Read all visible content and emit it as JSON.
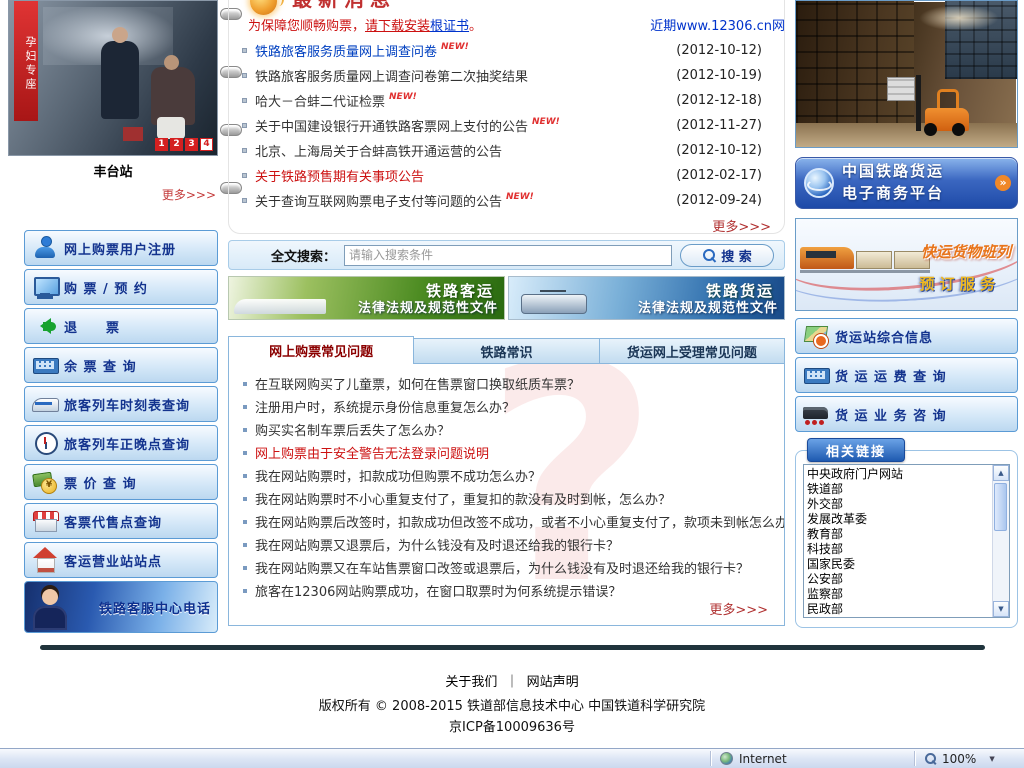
{
  "icons": {
    "scroll_up": "▲",
    "scroll_down": "▼",
    "dropdown_arrow": "▼",
    "arrow_badge": "»"
  },
  "top": {
    "heading": "最新消息",
    "notice_p1": "为保障您顺畅购票，",
    "notice_p2": "请下载安装",
    "notice_link": "根证书",
    "notice_suffix": "。",
    "notice_right": "近期www.12306.cn网"
  },
  "carousel": {
    "photo_banner": "孕妇专座",
    "caption": "丰台站",
    "more": "更多>>>",
    "pages": [
      "1",
      "2",
      "3",
      "4"
    ]
  },
  "left_menu": {
    "items": [
      {
        "label": "网上购票用户注册"
      },
      {
        "label": "购 票 / 预 约"
      },
      {
        "label": "退　　票"
      },
      {
        "label": "余 票 查 询"
      },
      {
        "label": "旅客列车时刻表查询"
      },
      {
        "label": "旅客列车正晚点查询"
      },
      {
        "label": "票 价 查 询"
      },
      {
        "label": "客票代售点查询"
      },
      {
        "label": "客运营业站站点"
      },
      {
        "label": "铁路客服中心电话"
      }
    ]
  },
  "news": {
    "new_label": "NEW!",
    "more": "更多>>>",
    "items": [
      {
        "title": "铁路旅客服务质量网上调查问卷",
        "date": "(2012-10-12)"
      },
      {
        "title": "铁路旅客服务质量网上调查问卷第二次抽奖结果",
        "date": "(2012-10-19)"
      },
      {
        "title": "哈大－合蚌二代证检票",
        "date": "(2012-12-18)"
      },
      {
        "title": "关于中国建设银行开通铁路客票网上支付的公告",
        "date": "(2012-11-27)"
      },
      {
        "title": "北京、上海局关于合蚌高铁开通运营的公告",
        "date": "(2012-10-12)"
      },
      {
        "title": "关于铁路预售期有关事项公告",
        "date": "(2012-02-17)"
      },
      {
        "title": "关于查询互联网购票电子支付等问题的公告",
        "date": "(2012-09-24)"
      }
    ]
  },
  "search": {
    "label": "全文搜索：",
    "placeholder": "请输入搜索条件",
    "button": "搜 索"
  },
  "legal_banners": {
    "passenger": {
      "title": "铁路客运",
      "subtitle": "法律法规及规范性文件"
    },
    "freight": {
      "title": "铁路货运",
      "subtitle": "法律法规及规范性文件"
    }
  },
  "faq": {
    "tabs": [
      "网上购票常见问题",
      "铁路常识",
      "货运网上受理常见问题"
    ],
    "watermark": "?",
    "more": "更多>>>",
    "items": [
      {
        "text": "在互联网购买了儿童票，如何在售票窗口换取纸质车票？"
      },
      {
        "text": "注册用户时，系统提示身份信息重复怎么办？"
      },
      {
        "text": "购买实名制车票后丢失了怎么办？"
      },
      {
        "text": "网上购票由于安全警告无法登录问题说明"
      },
      {
        "text": "我在网站购票时，扣款成功但购票不成功怎么办？"
      },
      {
        "text": "我在网站购票时不小心重复支付了，重复扣的款没有及时到帐，怎么办？"
      },
      {
        "text": "我在网站购票后改签时，扣款成功但改签不成功，或者不小心重复支付了，款项未到帐怎么办？"
      },
      {
        "text": "我在网站购票又退票后，为什么钱没有及时退还给我的银行卡？"
      },
      {
        "text": "我在网站购票又在车站售票窗口改签或退票后，为什么钱没有及时退还给我的银行卡？"
      },
      {
        "text": "旅客在12306网站购票成功，在窗口取票时为何系统提示错误？"
      }
    ]
  },
  "right_col": {
    "ecommerce": {
      "line1": "中国铁路货运",
      "line2": "电子商务平台"
    },
    "express": {
      "line1": "快运货物班列",
      "line2": "预 订 服 务"
    },
    "buttons": [
      {
        "label": "货运站综合信息"
      },
      {
        "label": "货 运 运 费 查 询"
      },
      {
        "label": "货 运 业 务 咨 询"
      }
    ],
    "related_links_title": "相关链接",
    "links": [
      "中央政府门户网站",
      "铁道部",
      "外交部",
      "发展改革委",
      "教育部",
      "科技部",
      "国家民委",
      "公安部",
      "监察部",
      "民政部"
    ]
  },
  "footer": {
    "link1": "关于我们",
    "separator": "｜",
    "link2": "网站声明",
    "copyright": "版权所有 © 2008-2015 铁道部信息技术中心 中国铁道科学研究院",
    "icp": "京ICP备10009636号"
  },
  "statusbar": {
    "zone": "Internet",
    "zoom": "100%"
  }
}
